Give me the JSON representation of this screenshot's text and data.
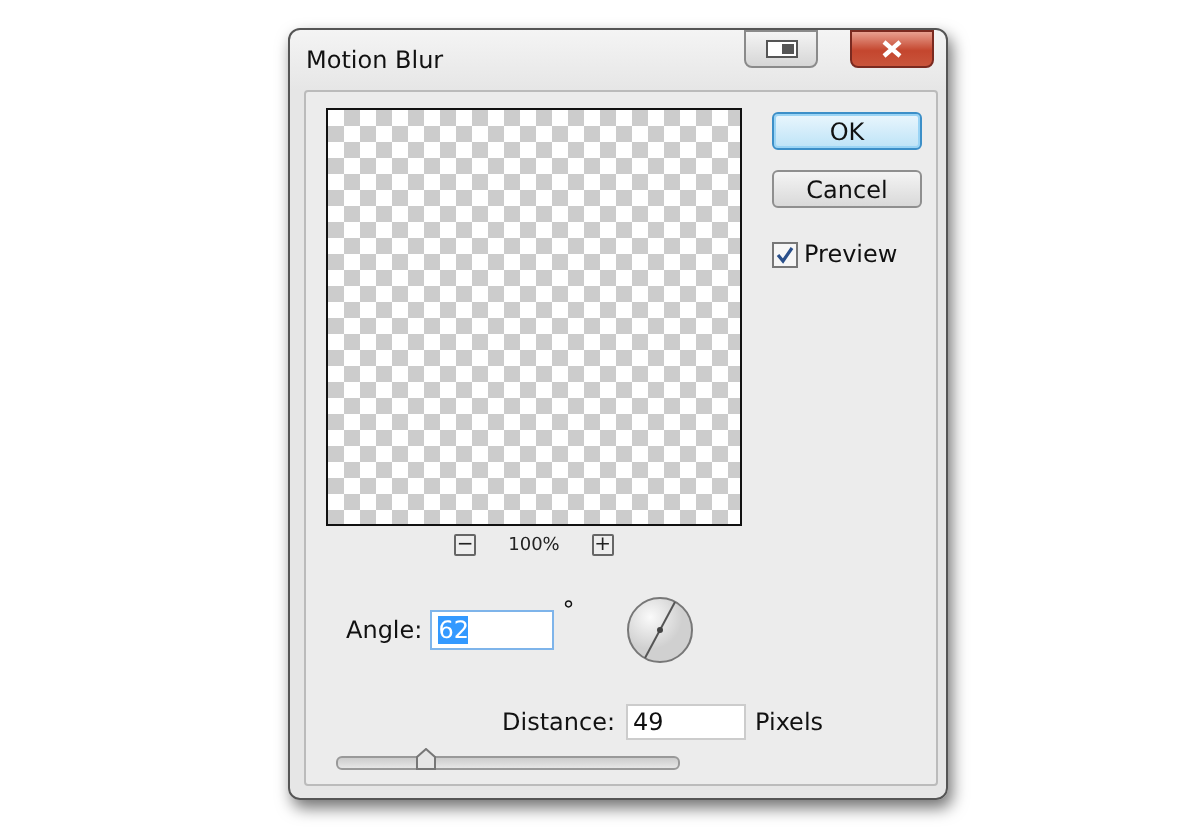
{
  "window": {
    "title": "Motion Blur"
  },
  "buttons": [
    {
      "label": "OK",
      "default": true
    },
    {
      "label": "Cancel",
      "default": false
    }
  ],
  "preview_checkbox": {
    "label": "Preview",
    "checked": true
  },
  "zoom": {
    "minus": "−",
    "plus": "+",
    "value": "100%"
  },
  "angle": {
    "label": "Angle:",
    "value": "62",
    "unit": "°"
  },
  "distance": {
    "label": "Distance:",
    "value": "49",
    "unit": "Pixels",
    "level": 0.26
  }
}
